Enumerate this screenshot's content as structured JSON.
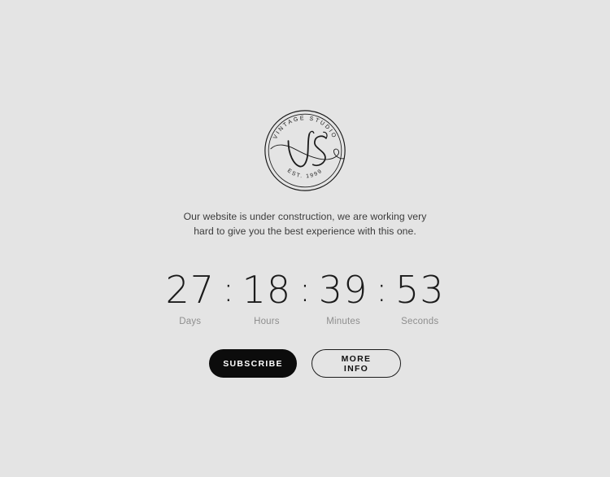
{
  "page": {
    "background_color": "#e4e4e4",
    "accent_color": "#0c0c0c",
    "muted_text_color": "#8e8e8e"
  },
  "logo": {
    "name": "vintage-studio-logo",
    "monogram": "VS",
    "top_arc_text": "VINTAGE STUDIO",
    "bottom_arc_text": "EST. 1999",
    "stroke_color": "#1b1b1b"
  },
  "intro": {
    "text": "Our website is under construction, we are working very hard to give you the best experience with this one."
  },
  "countdown": {
    "separator": ":",
    "units": [
      {
        "value": "27",
        "label": "Days"
      },
      {
        "value": "18",
        "label": "Hours"
      },
      {
        "value": "39",
        "label": "Minutes"
      },
      {
        "value": "53",
        "label": "Seconds"
      }
    ]
  },
  "buttons": {
    "subscribe_label": "SUBSCRIBE",
    "more_info_label": "MORE INFO"
  }
}
